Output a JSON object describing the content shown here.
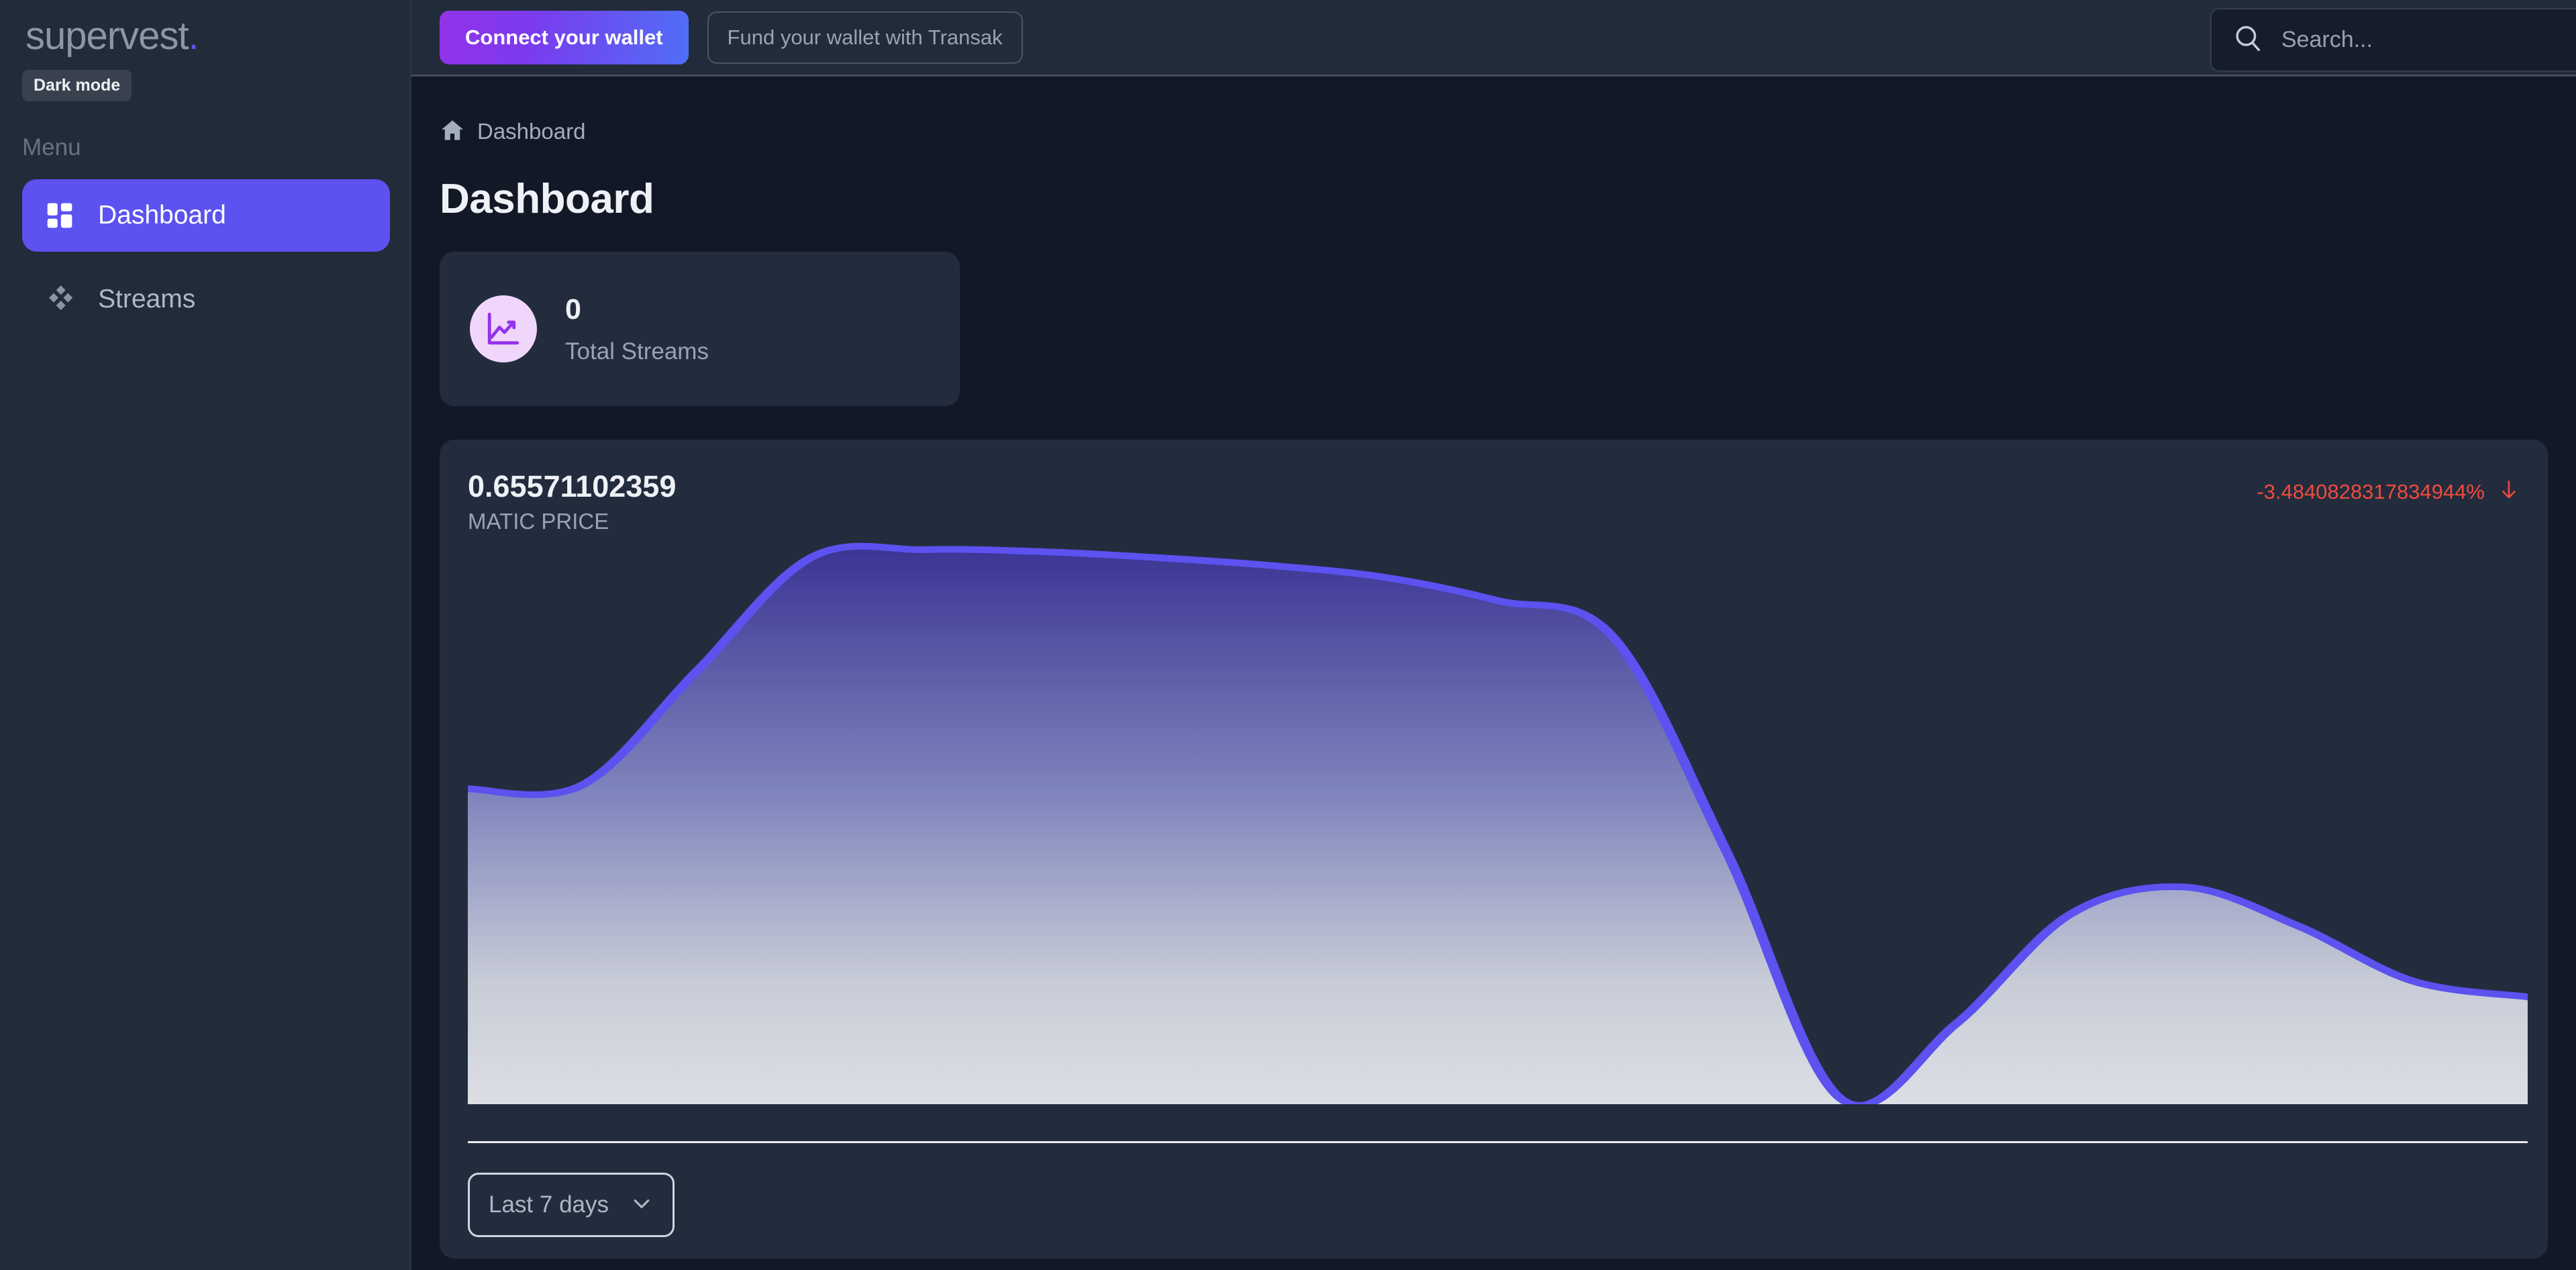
{
  "brand": {
    "name": "supervest",
    "dot": ".",
    "dark_mode_label": "Dark mode"
  },
  "sidebar": {
    "menu_label": "Menu",
    "items": [
      {
        "label": "Dashboard",
        "icon": "grid-icon",
        "active": true
      },
      {
        "label": "Streams",
        "icon": "diamonds-icon",
        "active": false
      }
    ]
  },
  "topbar": {
    "connect_wallet_label": "Connect your wallet",
    "fund_wallet_label": "Fund your wallet with Transak",
    "search": {
      "placeholder": "Search...",
      "value": "",
      "icon": "search-icon"
    },
    "theme_toggle_icon": "moon-icon",
    "notifications_icon": "bell-icon"
  },
  "breadcrumb": {
    "home_icon": "home-icon",
    "label": "Dashboard"
  },
  "page": {
    "title": "Dashboard"
  },
  "stat_card": {
    "icon": "line-chart-icon",
    "value": "0",
    "label": "Total Streams",
    "badge_color": "#f0d6fb",
    "icon_color": "#9333ea"
  },
  "price_card": {
    "price": "0.65571102359",
    "symbol_label": "MATIC PRICE",
    "change": "-3.4840828317834944%",
    "change_color": "#f04a3f",
    "change_direction_icon": "arrow-down-icon",
    "range_selector": {
      "selected": "Last 7 days",
      "chevron_icon": "chevron-down-icon",
      "options": [
        "Last 7 days"
      ]
    }
  },
  "chart_data": {
    "type": "area",
    "title": "MATIC PRICE",
    "series": [
      {
        "name": "MATIC price",
        "values": [
          0.679,
          0.68,
          0.709,
          0.738,
          0.74,
          0.7395,
          0.738,
          0.736,
          0.733,
          0.727,
          0.718,
          0.663,
          0.6,
          0.619,
          0.647,
          0.654,
          0.644,
          0.63,
          0.626
        ]
      }
    ],
    "x": [
      0,
      1,
      2,
      3,
      4,
      5,
      6,
      7,
      8,
      9,
      10,
      11,
      12,
      13,
      14,
      15,
      16,
      17,
      18
    ],
    "xlabel": "",
    "ylabel": "",
    "ylim": [
      0.6,
      0.741
    ],
    "grid": false,
    "legend": "none",
    "line_color": "#5b52f0",
    "fill_gradient_top": "#3b3494",
    "fill_gradient_bottom": "#dcdfe4",
    "range": "Last 7 days"
  }
}
